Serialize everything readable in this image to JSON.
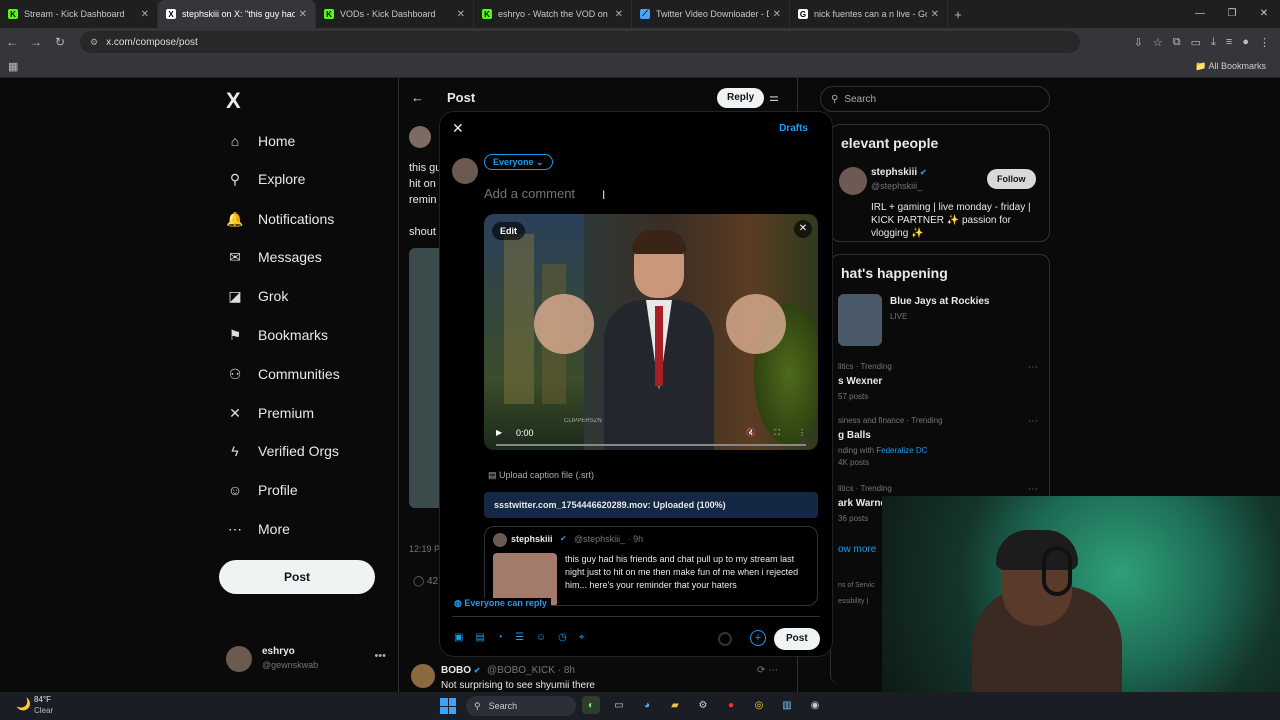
{
  "browser": {
    "tabs": [
      {
        "label": "Stream - Kick Dashboard",
        "fav": "K",
        "color": "#53fc18",
        "active": false
      },
      {
        "label": "stephskiii on X: \"this guy had h",
        "fav": "X",
        "color": "#ffffff",
        "active": true
      },
      {
        "label": "VODs - Kick Dashboard",
        "fav": "K",
        "color": "#53fc18",
        "active": false
      },
      {
        "label": "eshryo - Watch the VOD on Ki",
        "fav": "K",
        "color": "#53fc18",
        "active": false
      },
      {
        "label": "Twitter Video Downloader - Do",
        "fav": "⟋",
        "color": "#4aa3ff",
        "active": false
      },
      {
        "label": "nick fuentes can a n live - Goo",
        "fav": "G",
        "color": "#ffffff",
        "active": false
      }
    ],
    "url": "x.com/compose/post",
    "bookmarks_label": "All Bookmarks"
  },
  "sidenav": {
    "logo": "X",
    "items": [
      {
        "label": "Home",
        "icon": "⌂"
      },
      {
        "label": "Explore",
        "icon": "⚲"
      },
      {
        "label": "Notifications",
        "icon": "🔔"
      },
      {
        "label": "Messages",
        "icon": "✉"
      },
      {
        "label": "Grok",
        "icon": "◪"
      },
      {
        "label": "Bookmarks",
        "icon": "⚑"
      },
      {
        "label": "Communities",
        "icon": "⚇"
      },
      {
        "label": "Premium",
        "icon": "✕"
      },
      {
        "label": "Verified Orgs",
        "icon": "ϟ"
      },
      {
        "label": "Profile",
        "icon": "☺"
      },
      {
        "label": "More",
        "icon": "⋯"
      }
    ],
    "post_label": "Post",
    "account": {
      "name": "eshryo",
      "handle": "@gewnskwab"
    }
  },
  "main": {
    "title": "Post",
    "reply_label": "Reply",
    "bg_lines": [
      "this gu",
      "hit on",
      "remin",
      "shout"
    ],
    "bg_time": "12:19 P",
    "bg_count": "42",
    "bob": {
      "name": "BOBO",
      "handle": "@BOBO_KICK · 8h",
      "text": "Not surprising to see shyumii there"
    }
  },
  "right": {
    "search_placeholder": "Search",
    "relevant_title": "elevant people",
    "person": {
      "name": "stephskiii",
      "handle": "@stephskiii_",
      "follow": "Follow",
      "bio": "IRL + gaming | live monday - friday | KICK PARTNER ✨ passion for vlogging ✨"
    },
    "happening_title": "hat's happening",
    "bluejays": {
      "name": "Blue Jays at Rockies",
      "live": "LIVE"
    },
    "trends": [
      {
        "cat": "litics · Trending",
        "name": "s Wexner",
        "count": "57 posts"
      },
      {
        "cat": "siness and finance · Trending",
        "name": "g Balls",
        "count": "4K posts",
        "with": "nding with ",
        "with_link": "Federalize DC"
      },
      {
        "cat": "litics · Trending",
        "name": "ark Warne",
        "count": "36 posts"
      }
    ],
    "show_more": "ow more",
    "footer1": "ns of Servic",
    "footer2": "essibility  |"
  },
  "modal": {
    "drafts": "Drafts",
    "audience": "Everyone",
    "placeholder": "Add a comment",
    "video": {
      "edit": "Edit",
      "time": "0:00",
      "watermark": "CLIPPERSZN"
    },
    "caption": "Upload caption file (.srt)",
    "upload_status": "ssstwitter.com_1754446620289.mov: Uploaded (100%)",
    "quote": {
      "name": "stephskiii",
      "handle": "@stephskiii_ · 9h",
      "text": "this guy had his friends and chat pull up to my stream last night just to hit on me then make fun of me when i rejected him... here's your reminder that your haters"
    },
    "reply_setting": "Everyone can reply",
    "post_label": "Post"
  },
  "taskbar": {
    "temp": "84°F",
    "condition": "Clear",
    "search": "Search"
  }
}
